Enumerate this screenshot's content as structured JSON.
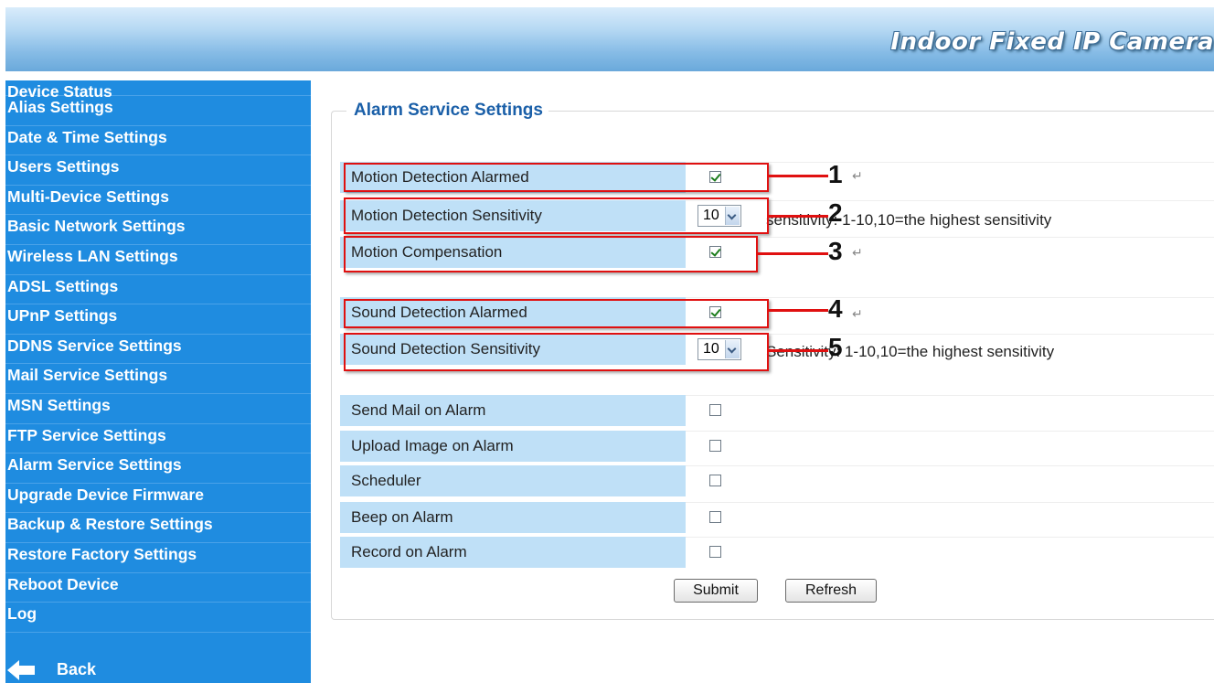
{
  "header": {
    "title": "Indoor Fixed IP Camera"
  },
  "sidebar": {
    "items": [
      "Device Status",
      "Alias Settings",
      "Date & Time Settings",
      "Users Settings",
      "Multi-Device Settings",
      "Basic Network Settings",
      "Wireless LAN Settings",
      "ADSL Settings",
      "UPnP Settings",
      "DDNS Service Settings",
      "Mail Service Settings",
      "MSN Settings",
      "FTP Service Settings",
      "Alarm Service Settings",
      "Upgrade Device Firmware",
      "Backup & Restore Settings",
      "Restore Factory Settings",
      "Reboot Device",
      "Log"
    ],
    "back_label": "Back"
  },
  "form": {
    "legend": "Alarm Service Settings",
    "motion_detection": {
      "label": "Motion Detection Alarmed",
      "checked": true
    },
    "motion_sensitivity": {
      "label": "Motion Detection Sensitivity",
      "value": "10",
      "hint": "sensitivity: 1-10,10=the highest sensitivity"
    },
    "motion_compensation": {
      "label": "Motion Compensation",
      "checked": true
    },
    "sound_detection": {
      "label": "Sound Detection Alarmed",
      "checked": true
    },
    "sound_sensitivity": {
      "label": "Sound Detection Sensitivity",
      "value": "10",
      "hint": "Sensitivity: 1-10,10=the highest sensitivity"
    },
    "send_mail": {
      "label": "Send Mail on Alarm",
      "checked": false
    },
    "upload_image": {
      "label": "Upload Image on Alarm",
      "checked": false
    },
    "scheduler": {
      "label": "Scheduler",
      "checked": false
    },
    "beep": {
      "label": "Beep on Alarm",
      "checked": false
    },
    "record": {
      "label": "Record on Alarm",
      "checked": false
    },
    "submit_label": "Submit",
    "refresh_label": "Refresh"
  },
  "callouts": [
    "1",
    "2",
    "3",
    "4",
    "5"
  ],
  "colors": {
    "sidebar": "#1f8ce0",
    "label_cell": "#bfe0f7",
    "legend": "#1a5fa8",
    "callout": "#e01010"
  }
}
